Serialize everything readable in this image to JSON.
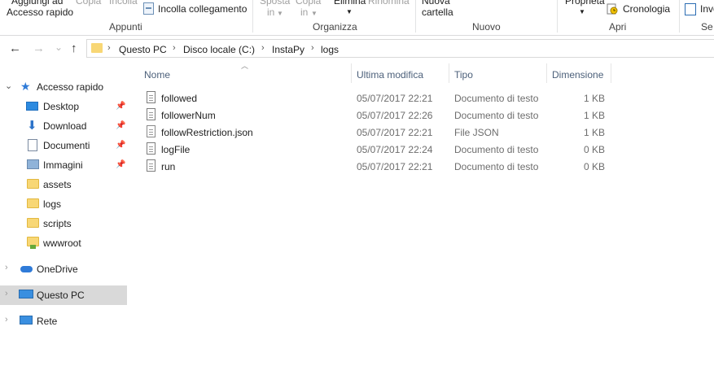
{
  "ribbon": {
    "appunti": {
      "add_quick_access_line1": "Aggiungi ad",
      "add_quick_access_line2": "Accesso rapido",
      "copy": "Copia",
      "paste": "Incolla",
      "paste_link": "Incolla collegamento",
      "group": "Appunti"
    },
    "organizza": {
      "move_to": "Sposta",
      "move_to_sub": "in",
      "copy_to": "Copia",
      "copy_to_sub": "in",
      "delete": "Elimina",
      "rename": "Rinomina",
      "group": "Organizza"
    },
    "nuovo": {
      "new_folder_line1": "Nuova",
      "new_folder_line2": "cartella",
      "group": "Nuovo"
    },
    "apri": {
      "properties": "Proprietà",
      "history": "Cronologia",
      "group": "Apri"
    },
    "seleziona": {
      "invert": "Inve",
      "group": "Se"
    }
  },
  "nav": {
    "back_icon": "←",
    "forward_icon": "→",
    "expand_icon": "⌄",
    "up_icon": "↑"
  },
  "breadcrumb": [
    "Questo PC",
    "Disco locale (C:)",
    "InstaPy",
    "logs"
  ],
  "breadcrumb_sep": "›",
  "sidebar": {
    "quick_access": "Accesso rapido",
    "pinned": [
      {
        "label": "Desktop",
        "icon": "desktop-icon"
      },
      {
        "label": "Download",
        "icon": "download-icon"
      },
      {
        "label": "Documenti",
        "icon": "documents-icon"
      },
      {
        "label": "Immagini",
        "icon": "images-icon"
      }
    ],
    "folders": [
      "assets",
      "logs",
      "scripts",
      "wwwroot"
    ],
    "onedrive": "OneDrive",
    "this_pc": "Questo PC",
    "network": "Rete",
    "pin_glyph": "📌",
    "expand_glyph": "›"
  },
  "columns": {
    "name": "Nome",
    "modified": "Ultima modifica",
    "type": "Tipo",
    "size": "Dimensione"
  },
  "files": [
    {
      "name": "followed",
      "modified": "05/07/2017 22:21",
      "type": "Documento di testo",
      "size": "1 KB"
    },
    {
      "name": "followerNum",
      "modified": "05/07/2017 22:26",
      "type": "Documento di testo",
      "size": "1 KB"
    },
    {
      "name": "followRestriction.json",
      "modified": "05/07/2017 22:21",
      "type": "File JSON",
      "size": "1 KB"
    },
    {
      "name": "logFile",
      "modified": "05/07/2017 22:24",
      "type": "Documento di testo",
      "size": "0 KB"
    },
    {
      "name": "run",
      "modified": "05/07/2017 22:21",
      "type": "Documento di testo",
      "size": "0 KB"
    }
  ],
  "colors": {
    "selection": "#d9d9d9",
    "folder": "#f8d775",
    "accent": "#2f7bd8"
  }
}
